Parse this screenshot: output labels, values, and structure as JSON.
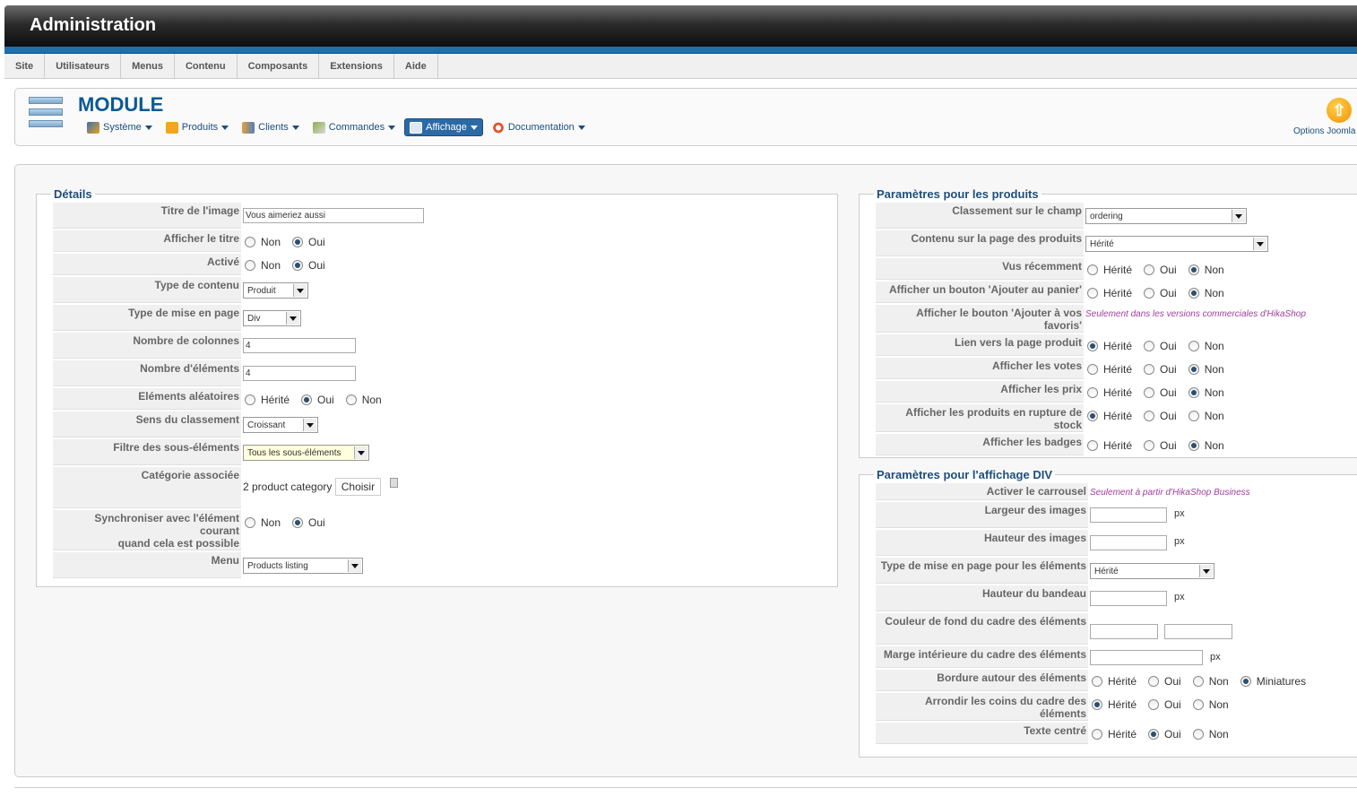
{
  "app": {
    "title": "Administration"
  },
  "topmenu": [
    "Site",
    "Utilisateurs",
    "Menus",
    "Contenu",
    "Composants",
    "Extensions",
    "Aide"
  ],
  "module": {
    "title": "MODULE",
    "submenu": [
      "Système",
      "Produits",
      "Clients",
      "Commandes",
      "Affichage",
      "Documentation"
    ],
    "active_submenu": "Affichage",
    "options_label": "Options Joomla !"
  },
  "details": {
    "legend": "Détails",
    "rows": {
      "titre_image": {
        "label": "Titre de l'image",
        "value": "Vous aimeriez aussi"
      },
      "afficher_titre": {
        "label": "Afficher le titre",
        "options": [
          "Non",
          "Oui"
        ],
        "selected": "Oui"
      },
      "active": {
        "label": "Activé",
        "options": [
          "Non",
          "Oui"
        ],
        "selected": "Oui"
      },
      "type_contenu": {
        "label": "Type de contenu",
        "value": "Produit"
      },
      "type_mise_page": {
        "label": "Type de mise en page",
        "value": "Div"
      },
      "nb_colonnes": {
        "label": "Nombre de colonnes",
        "value": "4"
      },
      "nb_elements": {
        "label": "Nombre d'éléments",
        "value": "4"
      },
      "elements_aleatoires": {
        "label": "Eléments aléatoires",
        "options": [
          "Hérité",
          "Oui",
          "Non"
        ],
        "selected": "Oui"
      },
      "sens_classement": {
        "label": "Sens du classement",
        "value": "Croissant"
      },
      "filtre": {
        "label": "Filtre des sous-éléments",
        "value": "Tous les sous-éléments"
      },
      "categorie": {
        "label": "Catégorie associée",
        "value": "2 product category",
        "button": "Choisir"
      },
      "synchroniser": {
        "label1": "Synchroniser avec l'élément courant",
        "label2": "quand cela est possible",
        "options": [
          "Non",
          "Oui"
        ],
        "selected": "Oui"
      },
      "menu": {
        "label": "Menu",
        "value": "Products listing"
      }
    }
  },
  "produits": {
    "legend": "Paramètres pour les produits",
    "rows": {
      "classement_champ": {
        "label": "Classement sur le champ",
        "value": "ordering"
      },
      "contenu_page": {
        "label": "Contenu sur la page des produits",
        "value": "Hérité"
      },
      "vus_recemment": {
        "label": "Vus récemment",
        "options": [
          "Hérité",
          "Oui",
          "Non"
        ],
        "selected": "Non"
      },
      "bouton_panier": {
        "label": "Afficher un bouton 'Ajouter au panier'",
        "options": [
          "Hérité",
          "Oui",
          "Non"
        ],
        "selected": "Non"
      },
      "bouton_favoris": {
        "label": "Afficher le bouton 'Ajouter à vos favoris'",
        "note": "Seulement dans les versions commerciales d'HikaShop"
      },
      "lien_produit": {
        "label": "Lien vers la page produit",
        "options": [
          "Hérité",
          "Oui",
          "Non"
        ],
        "selected": "Hérité"
      },
      "votes": {
        "label": "Afficher les votes",
        "options": [
          "Hérité",
          "Oui",
          "Non"
        ],
        "selected": "Non"
      },
      "prix": {
        "label": "Afficher les prix",
        "options": [
          "Hérité",
          "Oui",
          "Non"
        ],
        "selected": "Non"
      },
      "rupture": {
        "label": "Afficher les produits en rupture de stock",
        "options": [
          "Hérité",
          "Oui",
          "Non"
        ],
        "selected": "Hérité"
      },
      "badges": {
        "label": "Afficher les badges",
        "options": [
          "Hérité",
          "Oui",
          "Non"
        ],
        "selected": "Non"
      }
    }
  },
  "div": {
    "legend": "Paramètres pour l'affichage DIV",
    "px": "px",
    "rows": {
      "carrousel": {
        "label": "Activer le carrousel",
        "note": "Seulement à partir d'HikaShop Business"
      },
      "largeur_images": {
        "label": "Largeur des images",
        "value": ""
      },
      "hauteur_images": {
        "label": "Hauteur des images",
        "value": ""
      },
      "type_mise_page_el": {
        "label": "Type de mise en page pour les éléments",
        "value": "Hérité"
      },
      "hauteur_bandeau": {
        "label": "Hauteur du bandeau",
        "value": ""
      },
      "couleur_fond": {
        "label": "Couleur de fond du cadre des éléments",
        "value": ""
      },
      "marge": {
        "label": "Marge intérieure du cadre des éléments",
        "value": ""
      },
      "bordure": {
        "label": "Bordure autour des éléments",
        "options": [
          "Hérité",
          "Oui",
          "Non",
          "Miniatures"
        ],
        "selected": "Miniatures"
      },
      "arrondir": {
        "label": "Arrondir les coins du cadre des éléments",
        "options": [
          "Hérité",
          "Oui",
          "Non"
        ],
        "selected": "Hérité"
      },
      "texte_centre": {
        "label": "Texte centré",
        "options": [
          "Hérité",
          "Oui",
          "Non"
        ],
        "selected": "Oui"
      }
    }
  },
  "colors": {
    "accent": "#1d6fae",
    "heading": "#1d4d7c",
    "note": "#a03d9e"
  }
}
